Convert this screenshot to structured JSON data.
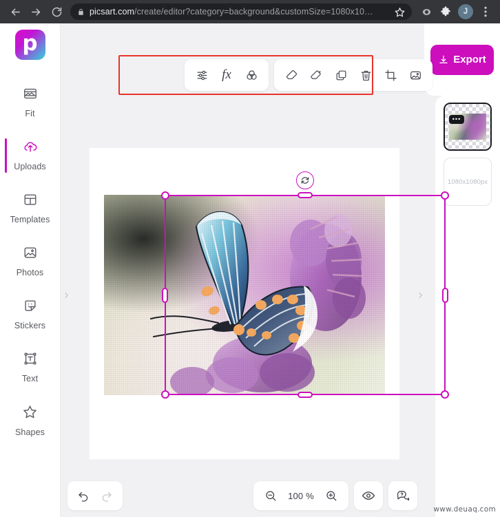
{
  "browser": {
    "back_icon": "arrow-left-icon",
    "forward_icon": "arrow-right-icon",
    "reload_icon": "reload-icon",
    "lock_icon": "lock-icon",
    "url_host": "picsart.com",
    "url_path": "/create/editor?category=background&customSize=1080x10…",
    "bookmark_icon": "star-icon",
    "extension_icon": "extension-icon",
    "puzzle_icon": "puzzle-piece-icon",
    "profile_initial": "J",
    "menu_icon": "kebab-menu-icon"
  },
  "sidebar": {
    "logo_letter": "p",
    "items": [
      {
        "label": "Fit",
        "icon": "fit-image-icon",
        "active": false
      },
      {
        "label": "Uploads",
        "icon": "upload-cloud-icon",
        "active": true
      },
      {
        "label": "Templates",
        "icon": "templates-grid-icon",
        "active": false
      },
      {
        "label": "Photos",
        "icon": "photo-icon",
        "active": false
      },
      {
        "label": "Stickers",
        "icon": "sticker-icon",
        "active": false
      },
      {
        "label": "Text",
        "icon": "text-box-icon",
        "active": false
      },
      {
        "label": "Shapes",
        "icon": "star-shape-icon",
        "active": false
      }
    ],
    "collapse_icon": "chevron-right-icon"
  },
  "toolbar": {
    "highlight_color": "#e8332a",
    "group_one": [
      {
        "name": "adjust-button",
        "icon": "sliders-icon",
        "label": "Adjust"
      },
      {
        "name": "effects-button",
        "icon": "fx-icon",
        "label": "fx"
      },
      {
        "name": "blend-button",
        "icon": "blend-circles-icon",
        "label": "Blend"
      }
    ],
    "group_two": [
      {
        "name": "eraser-button",
        "icon": "eraser-icon",
        "label": "Eraser"
      },
      {
        "name": "magic-eraser-button",
        "icon": "magic-eraser-icon",
        "label": "Magic Eraser"
      },
      {
        "name": "duplicate-button",
        "icon": "duplicate-icon",
        "label": "Duplicate"
      },
      {
        "name": "delete-button",
        "icon": "trash-icon",
        "label": "Delete"
      },
      {
        "name": "crop-button",
        "icon": "crop-icon",
        "label": "Crop"
      },
      {
        "name": "replace-image-button",
        "icon": "replace-image-icon",
        "label": "Replace"
      }
    ]
  },
  "canvas": {
    "selection_color": "#cc0ebd",
    "rotate_icon": "rotate-icon",
    "image_alt": "butterfly-on-purple-flowers"
  },
  "right_panel": {
    "export_label": "Export",
    "export_icon": "download-icon",
    "export_color": "#cc0ebd",
    "layers": [
      {
        "name": "layer-image",
        "badge": "•••",
        "selected": true,
        "caption": ""
      },
      {
        "name": "layer-background",
        "badge": "",
        "selected": false,
        "caption": "1080x1080px"
      }
    ],
    "collapse_icon": "chevron-right-icon"
  },
  "bottom_bar": {
    "undo_icon": "undo-icon",
    "redo_icon": "redo-icon",
    "zoom_out_icon": "zoom-out-icon",
    "zoom_level": "100 %",
    "zoom_in_icon": "zoom-in-icon",
    "preview_icon": "eye-icon",
    "help_icon": "help-chat-icon"
  },
  "watermark": "www.deuaq.com"
}
